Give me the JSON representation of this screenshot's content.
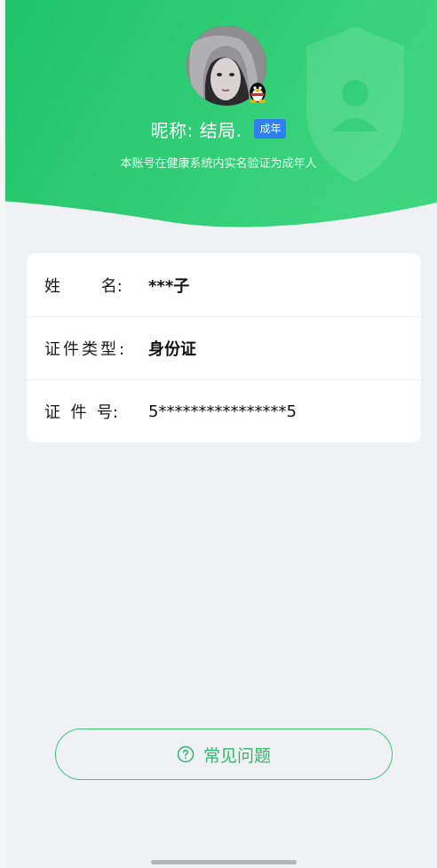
{
  "header": {
    "nickname": "昵称:  结局.",
    "adult_badge": "成年",
    "subtitle": "本账号在健康系统内实名验证为成年人"
  },
  "info": {
    "rows": [
      {
        "label": "姓        名:",
        "value": "***子"
      },
      {
        "label": "证件类型:",
        "value": "身份证"
      },
      {
        "label": "证  件  号:",
        "value": "5****************5"
      }
    ]
  },
  "footer": {
    "faq_label": "常见问题"
  },
  "colors": {
    "header_green": "#2fcc73",
    "badge_blue": "#2f7ff0",
    "faq_green": "#3cc878"
  },
  "icons": {
    "avatar_badge": "qq-penguin-icon",
    "watermark": "shield-person-icon",
    "faq": "question-circle-icon"
  }
}
